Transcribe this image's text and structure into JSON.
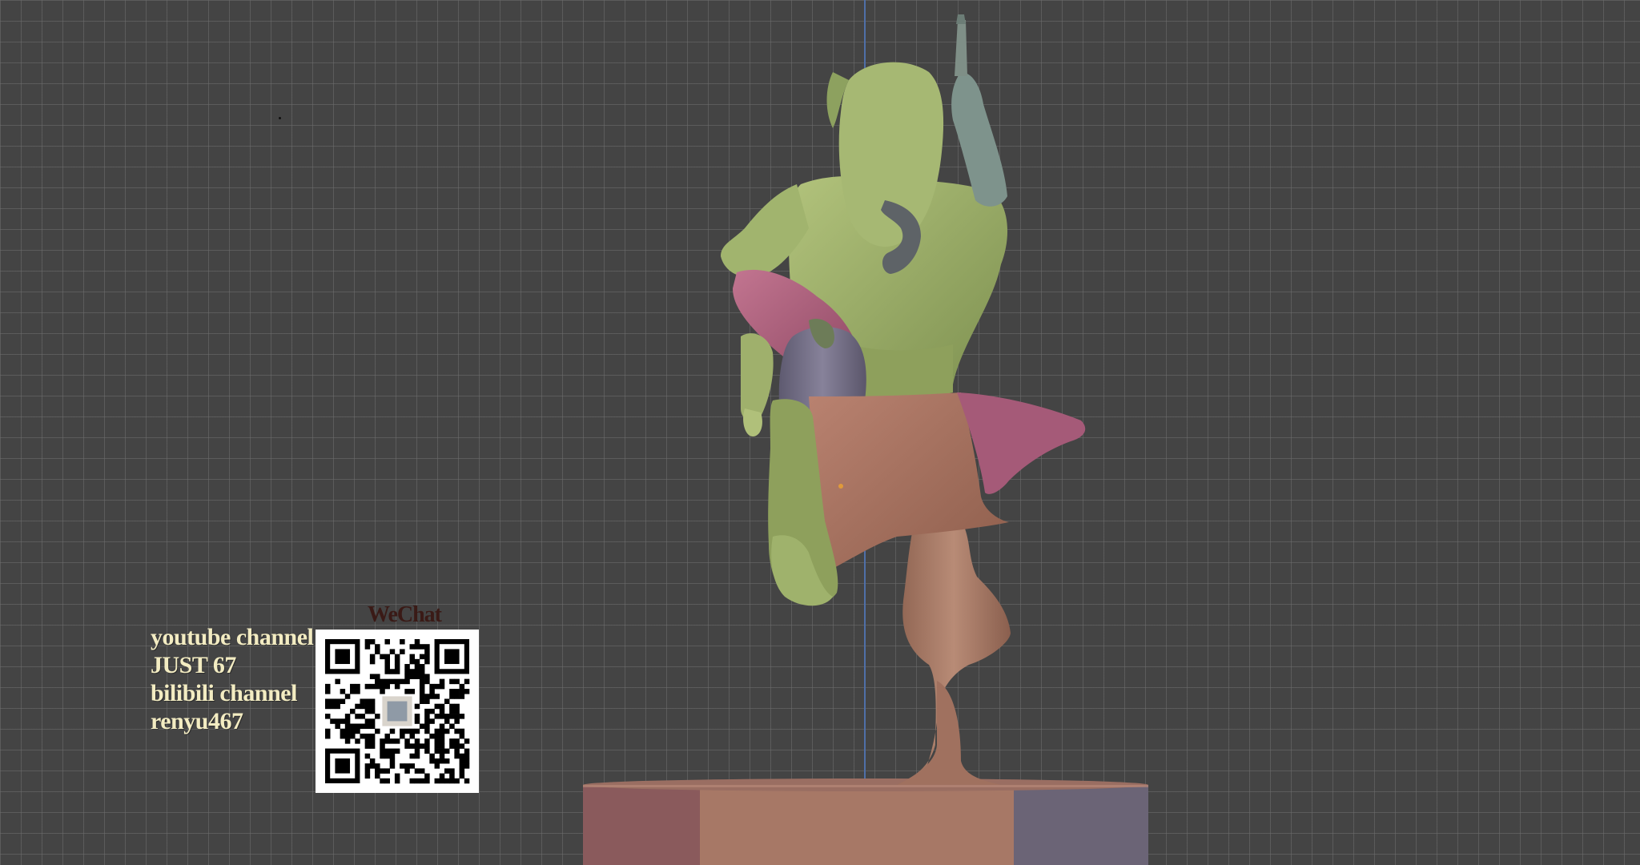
{
  "viewport": {
    "background": "#444444",
    "grid_color": "#6e6e6e",
    "axis_color": "#4f6fa8"
  },
  "model": {
    "icon": "sculpt-model",
    "colors": {
      "hood": "#9db06a",
      "sleeve_dark": "#7f8f55",
      "arm_gray": "#7e938c",
      "cloth_pink": "#a55a78",
      "child_pants": "#6e6a80",
      "apron": "#a5705c",
      "leg": "#a77c68",
      "base_left": "#8a5a5c",
      "base_mid": "#a77866",
      "base_right": "#6b6476"
    }
  },
  "overlay": {
    "channel_lines": [
      "youtube channel",
      "JUST 67",
      "bilibili channel",
      "renyu467"
    ],
    "wechat_label": "WeChat",
    "qr_icon": "qr-code-icon"
  }
}
